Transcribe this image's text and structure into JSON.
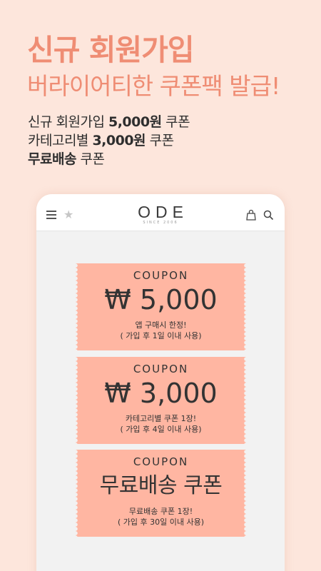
{
  "promo": {
    "headline": "신규 회원가입",
    "subhead": "버라이어티한 쿠폰팩 발급!",
    "benefits": [
      {
        "pre": "신규 회원가입 ",
        "bold": "5,000원",
        "post": " 쿠폰"
      },
      {
        "pre": "카테고리별 ",
        "bold": "3,000원",
        "post": " 쿠폰"
      },
      {
        "pre": "",
        "bold": "무료배송",
        "post": " 쿠폰"
      }
    ]
  },
  "app": {
    "logo": "ODE",
    "logo_sub": "SINCE 2006",
    "icons": [
      "menu-icon",
      "star-icon",
      "bag-icon",
      "search-icon"
    ]
  },
  "coupons": [
    {
      "label": "COUPON",
      "amount": "₩ 5,000",
      "note": "앱 구매시 한정!",
      "condition": "( 가입 후 1일 이내 사용)"
    },
    {
      "label": "COUPON",
      "amount": "₩ 3,000",
      "note": "카테고리별 쿠폰 1장!",
      "condition": "( 가입 후 4일 이내 사용)"
    },
    {
      "label": "COUPON",
      "amount": "무료배송 쿠폰",
      "note": "무료배송 쿠폰 1장!",
      "condition": "( 가입 후 30일 이내 사용)"
    }
  ],
  "colors": {
    "background": "#fde6dc",
    "accent": "#ef8d74",
    "coupon": "#ffb6a2"
  }
}
